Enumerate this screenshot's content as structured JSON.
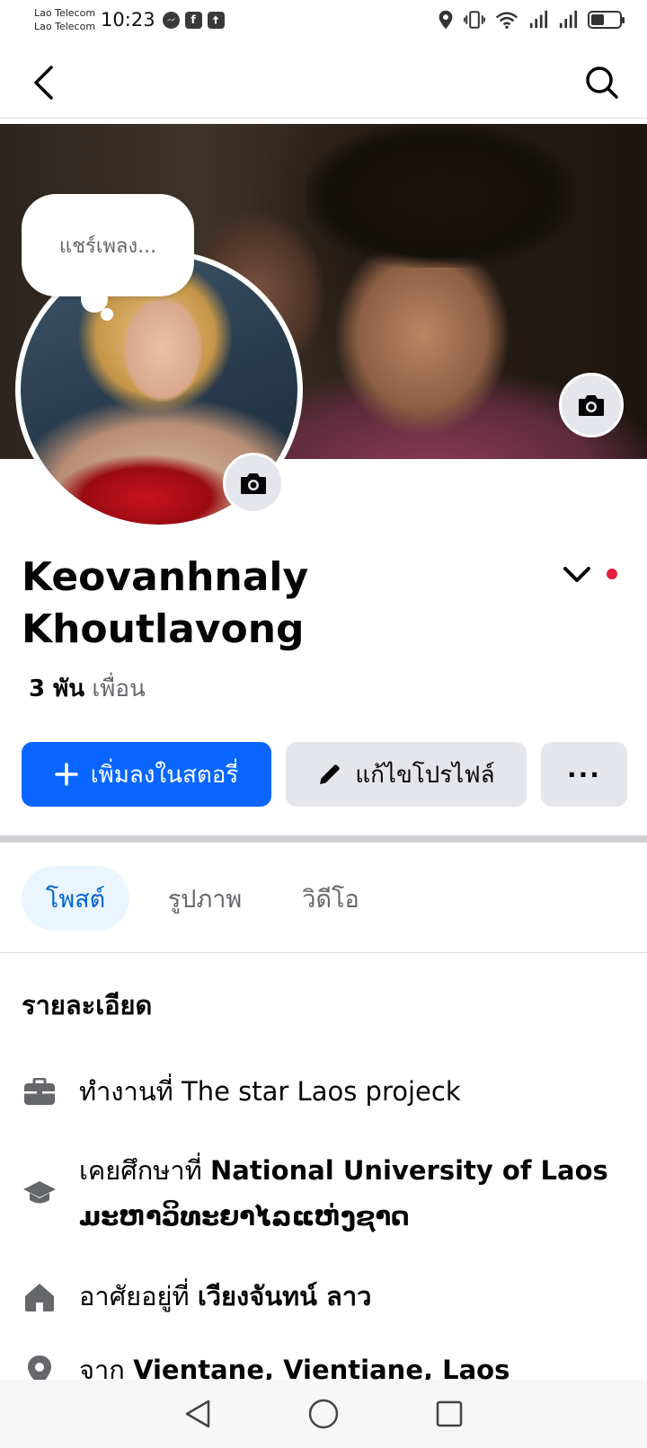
{
  "status_bar": {
    "carrier_1": "Lao Telecom",
    "carrier_2": "Lao Telecom",
    "time": "10:23",
    "battery_level": 0.45
  },
  "nav": {
    "back_icon": "chevron-left-icon",
    "search_icon": "search-icon"
  },
  "note": {
    "placeholder": "แชร์เพลง..."
  },
  "profile": {
    "name": "Keovanhnaly Khoutlavong",
    "friends_count": "3 พัน",
    "friends_label": "เพื่อน"
  },
  "actions": {
    "add_story": "เพิ่มลงในสตอรี่",
    "edit_profile": "แก้ไขโปรไฟล์",
    "more": "···"
  },
  "tabs": [
    {
      "label": "โพสต์",
      "active": true
    },
    {
      "label": "รูปภาพ",
      "active": false
    },
    {
      "label": "วิดีโอ",
      "active": false
    }
  ],
  "details": {
    "title": "รายละเอียด",
    "work_prefix": "ทำงานที่ The star Laos projeck",
    "edu_prefix": "เคยศึกษาที่ ",
    "edu_place": "National University of Laos ມະຫາວິທະຍາໄລແຫ່ງຊາດ",
    "home_prefix": "อาศัยอยู่ที่ ",
    "home_place": "เวียงจันทน์ ลาว",
    "from_prefix": "จาก ",
    "from_place": "Vientane, Vientiane, Laos"
  },
  "colors": {
    "primary": "#0866ff",
    "button_gray": "#e4e6eb",
    "active_tab_bg": "#ebf5ff",
    "active_tab_text": "#0064d1",
    "notification_dot": "#e41e3f"
  }
}
